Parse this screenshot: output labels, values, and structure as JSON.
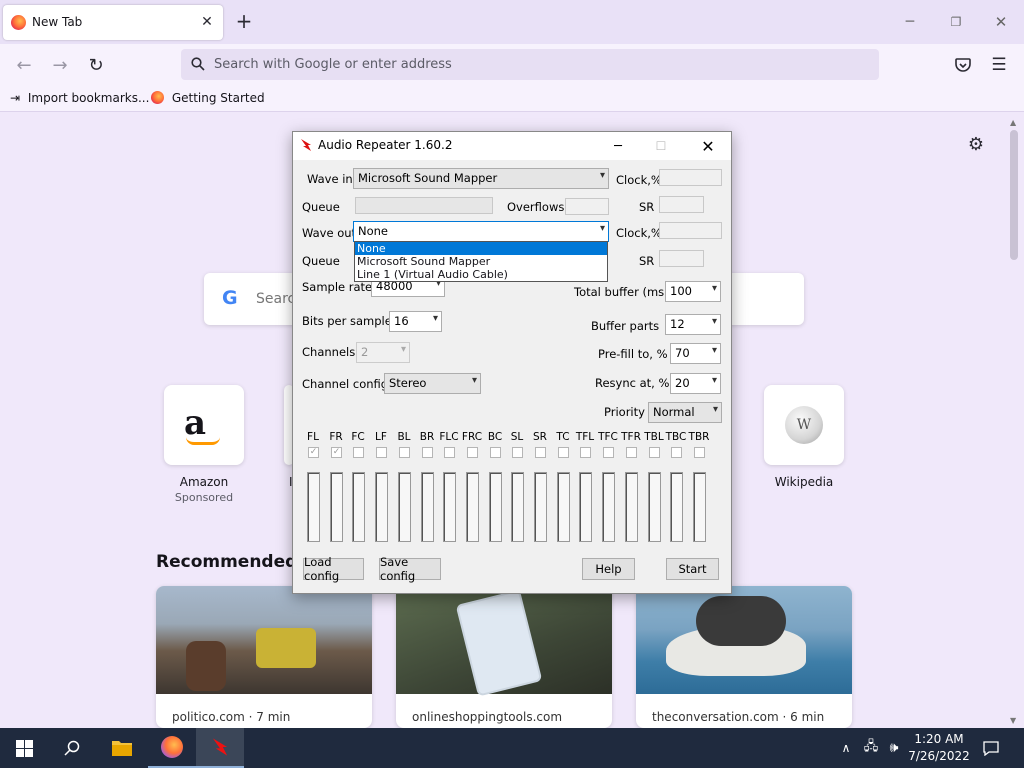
{
  "browser": {
    "tab_title": "New Tab",
    "url_placeholder": "Search with Google or enter address",
    "bookmarks": [
      "Import bookmarks...",
      "Getting Started"
    ]
  },
  "newtab": {
    "search_placeholder": "Search",
    "shortcuts": [
      {
        "name": "Amazon",
        "sub": "Sponsored",
        "icon": "amazon-icon"
      },
      {
        "name": "Wikipedia",
        "sub": "",
        "icon": "wikipedia-icon"
      }
    ],
    "recommended_heading": "Recommended by",
    "stories": [
      {
        "source": "politico.com · 7 min"
      },
      {
        "source": "onlineshoppingtools.com"
      },
      {
        "source": "theconversation.com · 6 min"
      }
    ]
  },
  "dialog": {
    "title": "Audio Repeater 1.60.2",
    "wave_in_label": "Wave in",
    "wave_in_value": "Microsoft Sound Mapper",
    "queue_label": "Queue",
    "overflows_label": "Overflows",
    "wave_out_label": "Wave out",
    "wave_out_value": "None",
    "clock_label": "Clock,%",
    "sr_label": "SR",
    "wave_out_options": [
      "None",
      "Microsoft Sound Mapper",
      "Line 1 (Virtual Audio Cable)"
    ],
    "sample_rate_label": "Sample rate",
    "sample_rate_value": "48000",
    "bits_label": "Bits per sample",
    "bits_value": "16",
    "channels_label": "Channels",
    "channels_value": "2",
    "channel_config_label": "Channel config",
    "channel_config_value": "Stereo",
    "total_buffer_label": "Total buffer (ms)",
    "total_buffer_value": "100",
    "buffer_parts_label": "Buffer parts",
    "buffer_parts_value": "12",
    "prefill_label": "Pre-fill to, %",
    "prefill_value": "70",
    "resync_label": "Resync at, %",
    "resync_value": "20",
    "priority_label": "Priority",
    "priority_value": "Normal",
    "channel_names": [
      "FL",
      "FR",
      "FC",
      "LF",
      "BL",
      "BR",
      "FLC",
      "FRC",
      "BC",
      "SL",
      "SR",
      "TC",
      "TFL",
      "TFC",
      "TFR",
      "TBL",
      "TBC",
      "TBR"
    ],
    "channel_checked": [
      true,
      true,
      false,
      false,
      false,
      false,
      false,
      false,
      false,
      false,
      false,
      false,
      false,
      false,
      false,
      false,
      false,
      false
    ],
    "buttons": {
      "load": "Load config",
      "save": "Save config",
      "help": "Help",
      "start": "Start"
    }
  },
  "taskbar": {
    "time": "1:20 AM",
    "date": "7/26/2022"
  }
}
